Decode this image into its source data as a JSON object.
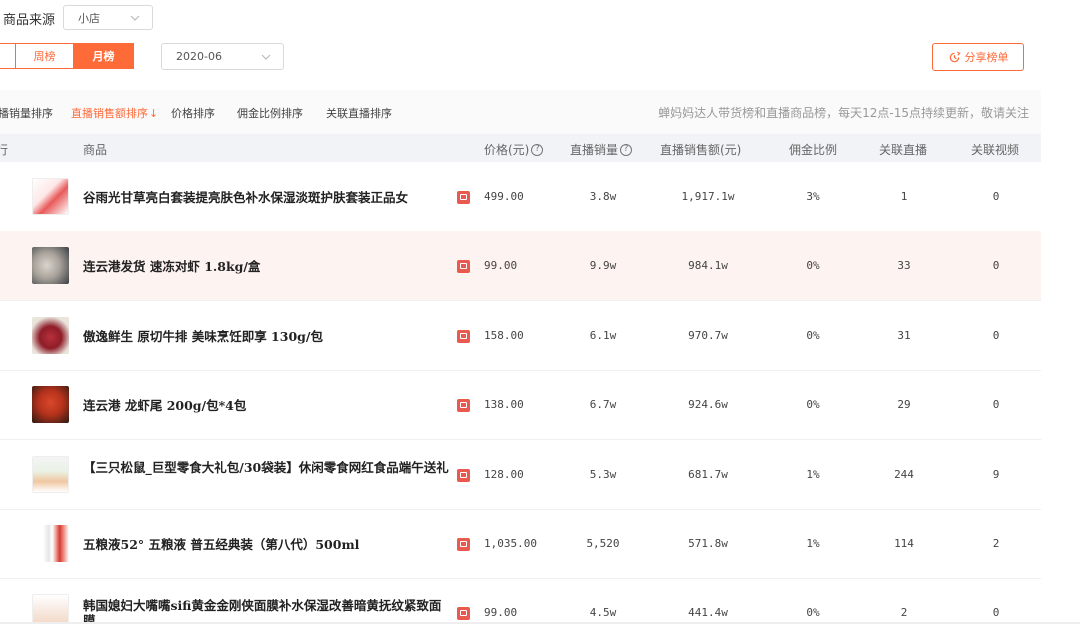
{
  "filters": {
    "source_label": "商品来源",
    "source_value": "小店",
    "period_tabs": [
      "",
      "周榜",
      "月榜"
    ],
    "active_period": "月榜",
    "date_value": "2020-06",
    "share_label": "分享榜单"
  },
  "sortbar": {
    "items": [
      "播销量排序",
      "直播销售额排序",
      "价格排序",
      "佣金比例排序",
      "关联直播排序"
    ],
    "active_arrow": "↓",
    "notice": "蝉妈妈达人带货榜和直播商品榜，每天12点-15点持续更新，敬请关注"
  },
  "table": {
    "headers": {
      "rank": "行",
      "product": "商品",
      "price": "价格(元)",
      "sales": "直播销量",
      "gmv": "直播销售额(元)",
      "commission": "佣金比例",
      "lives": "关联直播",
      "videos": "关联视频"
    },
    "rows": [
      {
        "name": "谷雨光甘草亮白套装提亮肤色补水保湿淡斑护肤套装正品女",
        "price": "499.00",
        "sales": "3.8w",
        "gmv": "1,917.1w",
        "commission": "3%",
        "lives": "1",
        "videos": "0"
      },
      {
        "name": "连云港发货 速冻对虾 1.8kg/盒",
        "price": "99.00",
        "sales": "9.9w",
        "gmv": "984.1w",
        "commission": "0%",
        "lives": "33",
        "videos": "0"
      },
      {
        "name": "傲逸鲜生 原切牛排 美味烹饪即享 130g/包",
        "price": "158.00",
        "sales": "6.1w",
        "gmv": "970.7w",
        "commission": "0%",
        "lives": "31",
        "videos": "0"
      },
      {
        "name": "连云港 龙虾尾 200g/包*4包",
        "price": "138.00",
        "sales": "6.7w",
        "gmv": "924.6w",
        "commission": "0%",
        "lives": "29",
        "videos": "0"
      },
      {
        "name": "【三只松鼠_巨型零食大礼包/30袋装】休闲零食网红食品端午送礼",
        "price": "128.00",
        "sales": "5.3w",
        "gmv": "681.7w",
        "commission": "1%",
        "lives": "244",
        "videos": "9"
      },
      {
        "name": "五粮液52° 五粮液 普五经典装（第八代）500ml",
        "price": "1,035.00",
        "sales": "5,520",
        "gmv": "571.8w",
        "commission": "1%",
        "lives": "114",
        "videos": "2"
      },
      {
        "name": "韩国媳妇大嘴嘴sifi黄金金刚侠面膜补水保湿改善暗黄抚纹紧致面膜",
        "price": "99.00",
        "sales": "4.5w",
        "gmv": "441.4w",
        "commission": "0%",
        "lives": "2",
        "videos": "0"
      }
    ]
  },
  "colors": {
    "accent": "#ff6a39",
    "highlight_row": "#fdf3f0",
    "shop_icon": "#e85a50"
  }
}
